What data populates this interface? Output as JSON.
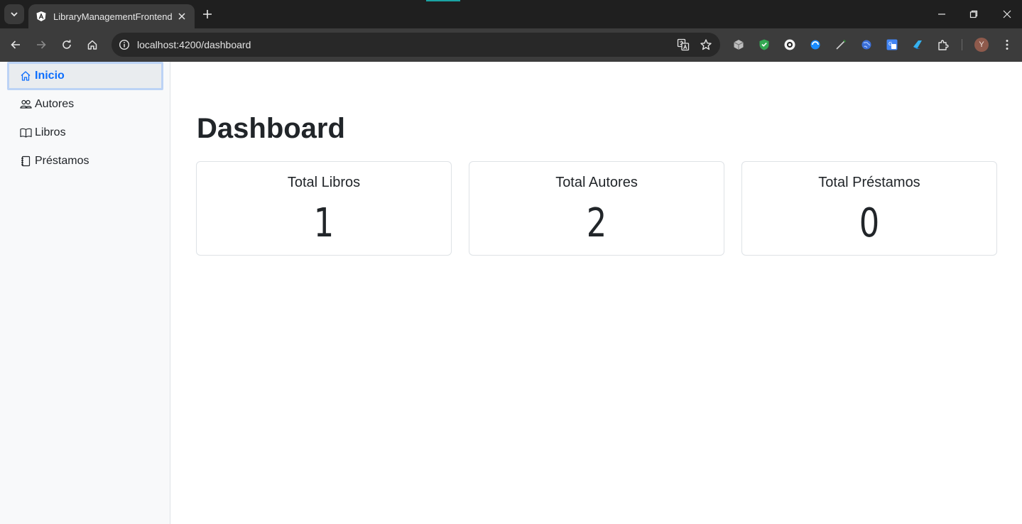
{
  "browser": {
    "tab_title": "LibraryManagementFrontend",
    "url_host": "localhost",
    "url_rest": ":4200/dashboard",
    "profile_initial": "Y",
    "colors": {
      "tabbar": "#1f1f1f",
      "toolbar": "#3c3c3c",
      "omnibox": "#282828",
      "accent_teal": "#1aa3a3"
    }
  },
  "sidebar": {
    "items": [
      {
        "label": "Inicio",
        "icon": "house-icon",
        "active": true
      },
      {
        "label": "Autores",
        "icon": "people-icon",
        "active": false
      },
      {
        "label": "Libros",
        "icon": "book-icon",
        "active": false
      },
      {
        "label": "Préstamos",
        "icon": "journal-icon",
        "active": false
      }
    ]
  },
  "main": {
    "title": "Dashboard",
    "cards": [
      {
        "title": "Total Libros",
        "value": "1"
      },
      {
        "title": "Total Autores",
        "value": "2"
      },
      {
        "title": "Total Préstamos",
        "value": "0"
      }
    ]
  },
  "colors": {
    "primary": "#0d6efd",
    "active_border": "#bcd3f5",
    "sidebar_bg": "#f8f9fa",
    "border": "#dee2e6",
    "text": "#212529"
  }
}
